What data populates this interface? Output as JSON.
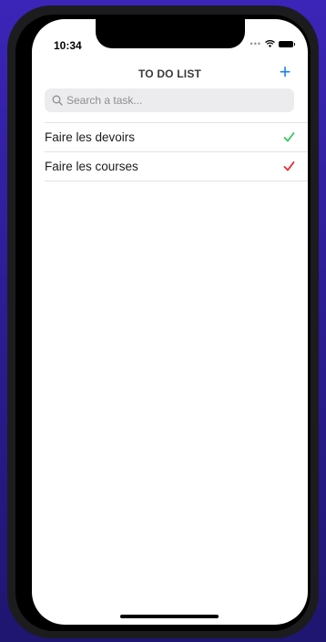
{
  "status_bar": {
    "time": "10:34",
    "icons": [
      "signal-dots-icon",
      "wifi-icon",
      "battery-icon"
    ]
  },
  "header": {
    "title": "TO DO LIST",
    "add_label": "+"
  },
  "search": {
    "placeholder": "Search a task...",
    "value": ""
  },
  "tasks": [
    {
      "label": "Faire les devoirs",
      "status_icon": "check-icon",
      "color": "#34c759"
    },
    {
      "label": "Faire les courses",
      "status_icon": "check-icon",
      "color": "#e8262c"
    }
  ],
  "colors": {
    "accent": "#1a82f0",
    "background": "#2c1d96"
  }
}
